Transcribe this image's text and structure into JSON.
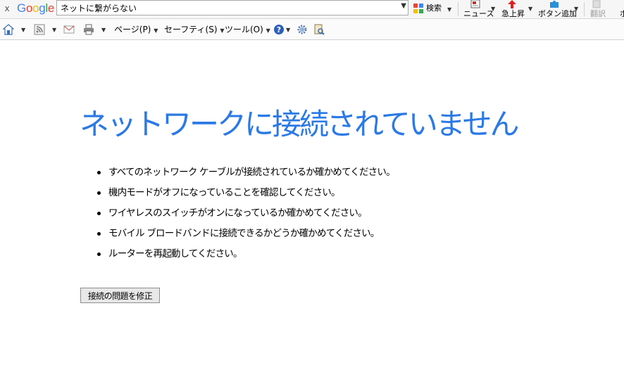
{
  "google_toolbar": {
    "close_label": "x",
    "logo_letters": [
      "G",
      "o",
      "o",
      "g",
      "l",
      "e"
    ],
    "logo_colors": [
      "#4285f4",
      "#ea4335",
      "#fbbc05",
      "#4285f4",
      "#34a853",
      "#ea4335"
    ],
    "search_value": "ネットに繋がらない",
    "search_button_label": "検索",
    "buttons": [
      {
        "label": "ニュース"
      },
      {
        "label": "急上昇"
      },
      {
        "label": "ボタン追加"
      },
      {
        "label": "翻訳"
      }
    ]
  },
  "command_bar": {
    "page_menu": "ページ(P)",
    "safety_menu": "セーフティ(S)",
    "tools_menu": "ツール(O)"
  },
  "content": {
    "headline": "ネットワークに接続されていません",
    "tips": [
      "すべてのネットワーク ケーブルが接続されているか確かめてください。",
      "機内モードがオフになっていることを確認してください。",
      "ワイヤレスのスイッチがオンになっているか確かめてください。",
      "モバイル ブロードバンドに接続できるかどうか確かめてください。",
      "ルーターを再起動してください。"
    ],
    "fix_button_label": "接続の問題を修正"
  },
  "colors": {
    "headline": "#2a79e4"
  }
}
